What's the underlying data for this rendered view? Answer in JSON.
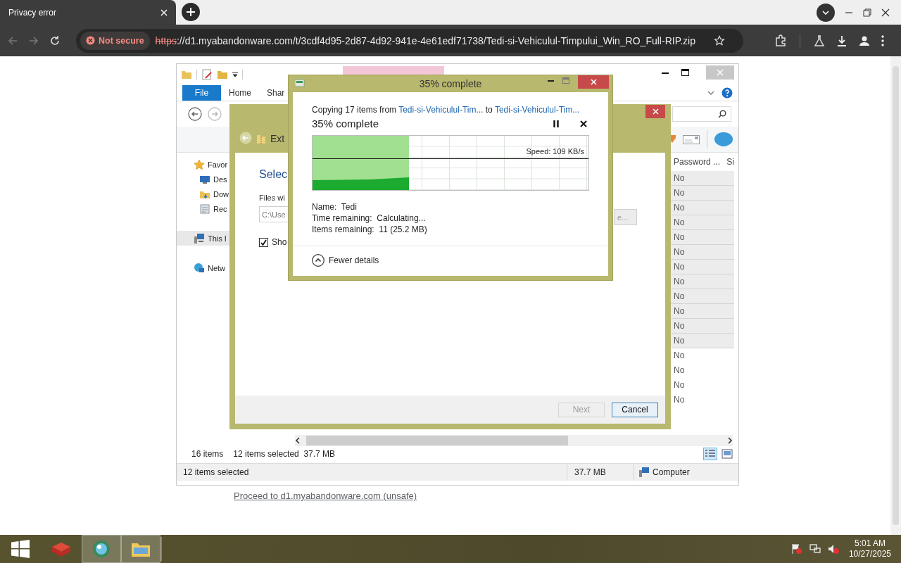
{
  "browser": {
    "tab_title": "Privacy error",
    "security_chip": "Not secure",
    "url_scheme": "https",
    "url_rest": "://d1.myabandonware.com/t/3cdf4d95-2d87-4d92-941e-4e61edf71738/Tedi-si-Vehiculul-Timpului_Win_RO_Full-RIP.zip"
  },
  "page": {
    "screenshot": {
      "explorer": {
        "ribbon_tabs": [
          {
            "label": "File",
            "selected": true
          },
          {
            "label": "Home",
            "selected": false
          },
          {
            "label": "Shar",
            "selected": false
          }
        ],
        "nav_items": [
          {
            "label": "Favor",
            "kind": "favorites",
            "selected": false
          },
          {
            "label": "Des",
            "kind": "desktop",
            "selected": false
          },
          {
            "label": "Dow",
            "kind": "downloads",
            "selected": false
          },
          {
            "label": "Rec",
            "kind": "recent",
            "selected": false
          },
          {
            "label": "This I",
            "kind": "computer",
            "selected": true
          },
          {
            "label": "Netw",
            "kind": "network",
            "selected": false
          }
        ],
        "columns": [
          "Password ...",
          "Si"
        ],
        "rows": [
          {
            "value": "No",
            "selected": true
          },
          {
            "value": "No",
            "selected": true
          },
          {
            "value": "No",
            "selected": true
          },
          {
            "value": "No",
            "selected": true
          },
          {
            "value": "No",
            "selected": true
          },
          {
            "value": "No",
            "selected": true
          },
          {
            "value": "No",
            "selected": true
          },
          {
            "value": "No",
            "selected": true
          },
          {
            "value": "No",
            "selected": true
          },
          {
            "value": "No",
            "selected": true
          },
          {
            "value": "No",
            "selected": true
          },
          {
            "value": "No",
            "selected": true
          },
          {
            "value": "No",
            "selected": false
          },
          {
            "value": "No",
            "selected": false
          },
          {
            "value": "No",
            "selected": false
          },
          {
            "value": "No",
            "selected": false
          }
        ],
        "item_count": "16 items",
        "selection_count": "12 items selected",
        "selection_size": "37.7 MB",
        "status_bar": {
          "selected": "12 items selected",
          "size": "37.7 MB",
          "location": "Computer"
        }
      },
      "extract_dialog": {
        "title": "Ext",
        "heading": "Selec",
        "files_label": "Files wi",
        "path_value": "C:\\Use",
        "browse": "e...",
        "show_checkbox": {
          "label": "Sho",
          "checked": true
        },
        "buttons": [
          {
            "label": "Next",
            "disabled": true
          },
          {
            "label": "Cancel",
            "disabled": false
          }
        ]
      },
      "progress_dialog": {
        "title": "35% complete",
        "copy_prefix": "Copying 17 items from",
        "source": "Tedi-si-Vehiculul-Tim...",
        "copy_to": "to",
        "destination": "Tedi-si-Vehiculul-Tim...",
        "status": "35% complete",
        "level": 0.35,
        "speed": "Speed: 109 KB/s",
        "details": [
          "Name:  Tedi",
          "Time remaining:  Calculating...",
          "Items remaining:  11 (25.2 MB)"
        ],
        "toggle": "Fewer details"
      }
    },
    "proceed_link": "Proceed to d1.myabandonware.com (unsafe)"
  },
  "taskbar": {
    "time": "5:01 AM",
    "date": "10/27/2025"
  }
}
